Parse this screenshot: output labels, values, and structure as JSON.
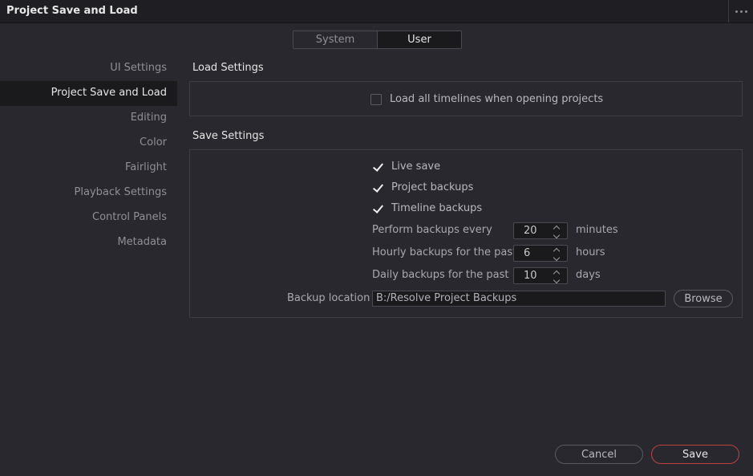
{
  "window": {
    "title": "Project Save and Load"
  },
  "tabs": [
    {
      "label": "System",
      "active": false
    },
    {
      "label": "User",
      "active": true
    }
  ],
  "sidebar": {
    "items": [
      {
        "label": "UI Settings"
      },
      {
        "label": "Project Save and Load",
        "selected": true
      },
      {
        "label": "Editing"
      },
      {
        "label": "Color"
      },
      {
        "label": "Fairlight"
      },
      {
        "label": "Playback Settings"
      },
      {
        "label": "Control Panels"
      },
      {
        "label": "Metadata"
      }
    ]
  },
  "load_settings": {
    "title": "Load Settings",
    "load_all_timelines": {
      "label": "Load all timelines when opening projects",
      "checked": false
    }
  },
  "save_settings": {
    "title": "Save Settings",
    "live_save": {
      "label": "Live save",
      "checked": true
    },
    "project_backups": {
      "label": "Project backups",
      "checked": true
    },
    "timeline_backups": {
      "label": "Timeline backups",
      "checked": true
    },
    "perform_every": {
      "label": "Perform backups every",
      "value": "20",
      "unit": "minutes"
    },
    "hourly": {
      "label": "Hourly backups for the past",
      "value": "6",
      "unit": "hours"
    },
    "daily": {
      "label": "Daily backups for the past",
      "value": "10",
      "unit": "days"
    },
    "backup_location": {
      "label": "Backup location",
      "value": "B:/Resolve Project Backups"
    },
    "browse_label": "Browse"
  },
  "footer": {
    "cancel_label": "Cancel",
    "save_label": "Save"
  },
  "colors": {
    "background": "#28282e",
    "save_accent": "#c0423e"
  }
}
